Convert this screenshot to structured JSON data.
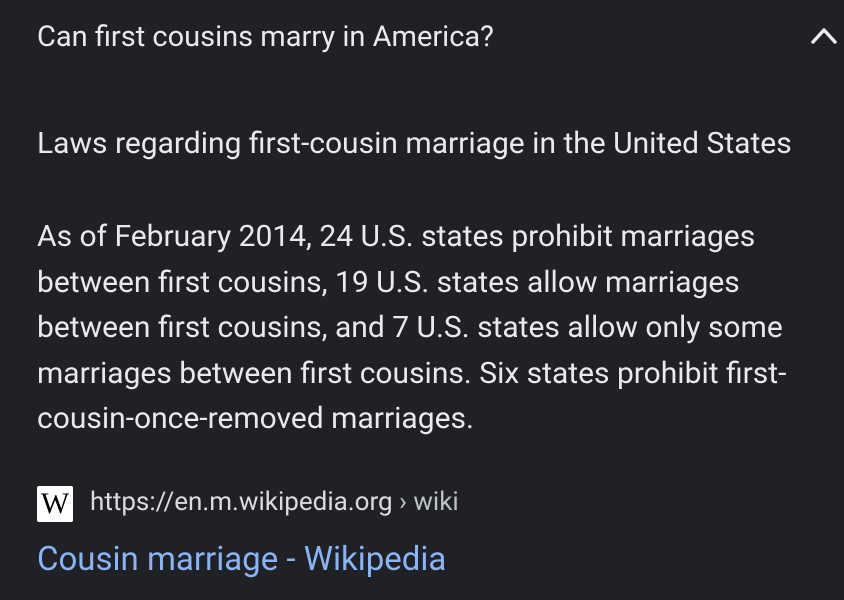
{
  "question": {
    "text": "Can first cousins marry in America?",
    "toggle_icon": "chevron-up-icon"
  },
  "answer": {
    "heading": "Laws regarding first-cousin marriage in the United States",
    "paragraph": "As of February 2014, 24 U.S. states prohibit marriages between first cousins, 19 U.S. states allow marriages between first cousins, and 7 U.S. states allow only some marriages between first cousins. Six states prohibit first-cousin-once-removed marriages."
  },
  "source": {
    "favicon_letter": "W",
    "favicon_icon": "wikipedia-favicon-icon",
    "url": "https://en.m.wikipedia.org",
    "breadcrumb": " › wiki",
    "title": "Cousin marriage - Wikipedia"
  },
  "colors": {
    "background": "#202124",
    "text": "#e8eaed",
    "link": "#8ab4f8"
  }
}
